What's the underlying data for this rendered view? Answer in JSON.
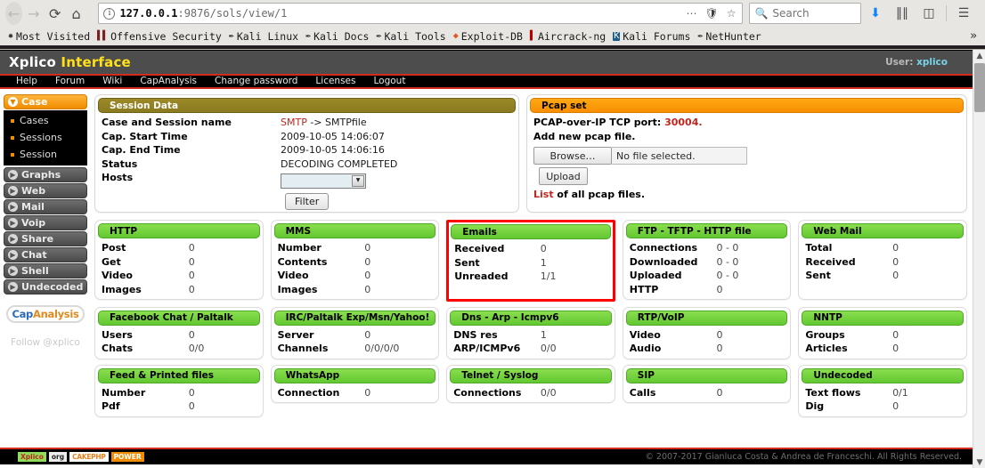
{
  "browser": {
    "nav": {
      "back_icon": "arrow-left-icon",
      "forward_icon": "arrow-right-icon",
      "reload_icon": "reload-icon",
      "home_icon": "home-icon"
    },
    "url": {
      "info_icon": "page-info-icon",
      "host": "127.0.0.1",
      "path": ":9876/sols/view/1",
      "page_actions_icon": "ellipsis-icon",
      "shield_icon": "tracking-protection-shield-icon",
      "bookmark_icon": "star-icon"
    },
    "search": {
      "placeholder": "Search",
      "icon": "search-icon"
    },
    "toolbar_right": [
      {
        "name": "downloads-icon",
        "glyph": "⬇"
      },
      {
        "name": "library-icon",
        "glyph": "Ⅱ‖"
      },
      {
        "name": "sidebars-icon",
        "glyph": "◫"
      },
      {
        "name": "menu-hamburger-icon",
        "glyph": "≡"
      }
    ],
    "bookmarks": [
      {
        "label": "Most Visited",
        "icon": "star-icon",
        "glyph": "✸",
        "cls": "fav-star"
      },
      {
        "label": "Offensive Security",
        "icon": "offensive-security-icon",
        "glyph": "▌▌",
        "cls": "fav-dragon"
      },
      {
        "label": "Kali Linux",
        "icon": "kali-linux-icon",
        "glyph": "✒",
        "cls": "fav-pen"
      },
      {
        "label": "Kali Docs",
        "icon": "kali-docs-icon",
        "glyph": "✒",
        "cls": "fav-pen"
      },
      {
        "label": "Kali Tools",
        "icon": "kali-tools-icon",
        "glyph": "✒",
        "cls": "fav-pen"
      },
      {
        "label": "Exploit-DB",
        "icon": "exploit-db-icon",
        "glyph": "◆",
        "cls": "fav-fire"
      },
      {
        "label": "Aircrack-ng",
        "icon": "aircrack-ng-icon",
        "glyph": "▌",
        "cls": "fav-book"
      },
      {
        "label": "Kali Forums",
        "icon": "kali-forums-icon",
        "glyph": "K",
        "cls": "fav-kali"
      },
      {
        "label": "NetHunter",
        "icon": "nethunter-icon",
        "glyph": "✒",
        "cls": "fav-pen"
      }
    ],
    "bookmarks_overflow": "»"
  },
  "app": {
    "logo_left": "Xplico",
    "logo_right": "Interface",
    "user_label": "User:",
    "user_name": "xplico",
    "menu": [
      "Help",
      "Forum",
      "Wiki",
      "CapAnalysis",
      "Change password",
      "Licenses",
      "Logout"
    ]
  },
  "sidebar": {
    "case_group": {
      "title": "Case",
      "items": [
        "Cases",
        "Sessions",
        "Session"
      ]
    },
    "groups": [
      "Graphs",
      "Web",
      "Mail",
      "Voip",
      "Share",
      "Chat",
      "Shell",
      "Undecoded"
    ],
    "capanalysis_cap": "Cap",
    "capanalysis_analysis": "Analysis",
    "follow": "Follow @xplico"
  },
  "session_panel": {
    "title": "Session Data",
    "rows": [
      {
        "key": "Case and Session name",
        "value_red": "SMTP",
        "value_rest": " -> SMTPfile"
      },
      {
        "key": "Cap. Start Time",
        "value": "2009-10-05 14:06:07"
      },
      {
        "key": "Cap. End Time",
        "value": "2009-10-05 14:06:16"
      },
      {
        "key": "Status",
        "value": "DECODING COMPLETED"
      },
      {
        "key": "Hosts",
        "value": ""
      }
    ],
    "hosts_selected": "",
    "filter_button": "Filter"
  },
  "pcap_panel": {
    "title": "Pcap set",
    "port_label": "PCAP-over-IP TCP port:",
    "port_value": "30004.",
    "add_label": "Add new pcap file.",
    "browse_button": "Browse…",
    "file_status": "No file selected.",
    "upload_button": "Upload",
    "list_link": "List",
    "list_rest": " of all pcap files."
  },
  "stats": [
    [
      {
        "title": "HTTP",
        "highlight": false,
        "rows": [
          [
            "Post",
            "0"
          ],
          [
            "Get",
            "0"
          ],
          [
            "Video",
            "0"
          ],
          [
            "Images",
            "0"
          ]
        ]
      },
      {
        "title": "MMS",
        "highlight": false,
        "rows": [
          [
            "Number",
            "0"
          ],
          [
            "Contents",
            "0"
          ],
          [
            "Video",
            "0"
          ],
          [
            "Images",
            "0"
          ]
        ]
      },
      {
        "title": "Emails",
        "highlight": true,
        "rows": [
          [
            "Received",
            "0"
          ],
          [
            "Sent",
            "1"
          ],
          [
            "Unreaded",
            "1/1"
          ]
        ]
      },
      {
        "title": "FTP - TFTP - HTTP file",
        "highlight": false,
        "rows": [
          [
            "Connections",
            "0 - 0"
          ],
          [
            "Downloaded",
            "0 - 0"
          ],
          [
            "Uploaded",
            "0 - 0"
          ],
          [
            "HTTP",
            "0"
          ]
        ]
      },
      {
        "title": "Web Mail",
        "highlight": false,
        "rows": [
          [
            "Total",
            "0"
          ],
          [
            "Received",
            "0"
          ],
          [
            "Sent",
            "0"
          ]
        ]
      }
    ],
    [
      {
        "title": "Facebook Chat / Paltalk",
        "highlight": false,
        "rows": [
          [
            "Users",
            "0"
          ],
          [
            "Chats",
            "0/0"
          ]
        ]
      },
      {
        "title": "IRC/Paltalk Exp/Msn/Yahoo!",
        "highlight": false,
        "rows": [
          [
            "Server",
            "0"
          ],
          [
            "Channels",
            "0/0/0/0"
          ]
        ]
      },
      {
        "title": "Dns - Arp - Icmpv6",
        "highlight": false,
        "rows": [
          [
            "DNS res",
            "1"
          ],
          [
            "ARP/ICMPv6",
            "0/0"
          ]
        ]
      },
      {
        "title": "RTP/VoIP",
        "highlight": false,
        "rows": [
          [
            "Video",
            "0"
          ],
          [
            "Audio",
            "0"
          ]
        ]
      },
      {
        "title": "NNTP",
        "highlight": false,
        "rows": [
          [
            "Groups",
            "0"
          ],
          [
            "Articles",
            "0"
          ]
        ]
      }
    ],
    [
      {
        "title": "Feed & Printed files",
        "highlight": false,
        "rows": [
          [
            "Number",
            "0"
          ],
          [
            "Pdf",
            "0"
          ]
        ]
      },
      {
        "title": "WhatsApp",
        "highlight": false,
        "rows": [
          [
            "Connection",
            "0"
          ]
        ]
      },
      {
        "title": "Telnet / Syslog",
        "highlight": false,
        "rows": [
          [
            "Connections",
            "0/0"
          ]
        ]
      },
      {
        "title": "SIP",
        "highlight": false,
        "rows": [
          [
            "Calls",
            "0"
          ]
        ]
      },
      {
        "title": "Undecoded",
        "highlight": false,
        "rows": [
          [
            "Text flows",
            "0/1"
          ],
          [
            "Dig",
            "0"
          ]
        ]
      }
    ]
  ],
  "footer": {
    "badges": [
      {
        "text": "Xplico",
        "cls": "badge-xplico",
        "name": "xplico-badge"
      },
      {
        "text": "org",
        "cls": "badge-org",
        "name": "org-badge"
      },
      {
        "text": "CAKEPHP",
        "cls": "badge-cake",
        "name": "cakephp-badge"
      },
      {
        "text": "POWER",
        "cls": "badge-power",
        "name": "power-badge"
      }
    ],
    "copyright": "© 2007-2017 Gianluca Costa & Andrea de Franceschi. All Rights Reserved."
  },
  "scrollbar": {
    "up": "▲",
    "down": "▼"
  },
  "colors": {
    "accent_orange": "#f08c00",
    "menu_red": "#d42b1f",
    "panel_green": "#62c832",
    "panel_olive": "#8a7a20",
    "highlight_red": "#fe0000",
    "link_red": "#c0261d",
    "user_cyan": "#77d4e8",
    "logo_yellow": "#ffe01a"
  }
}
